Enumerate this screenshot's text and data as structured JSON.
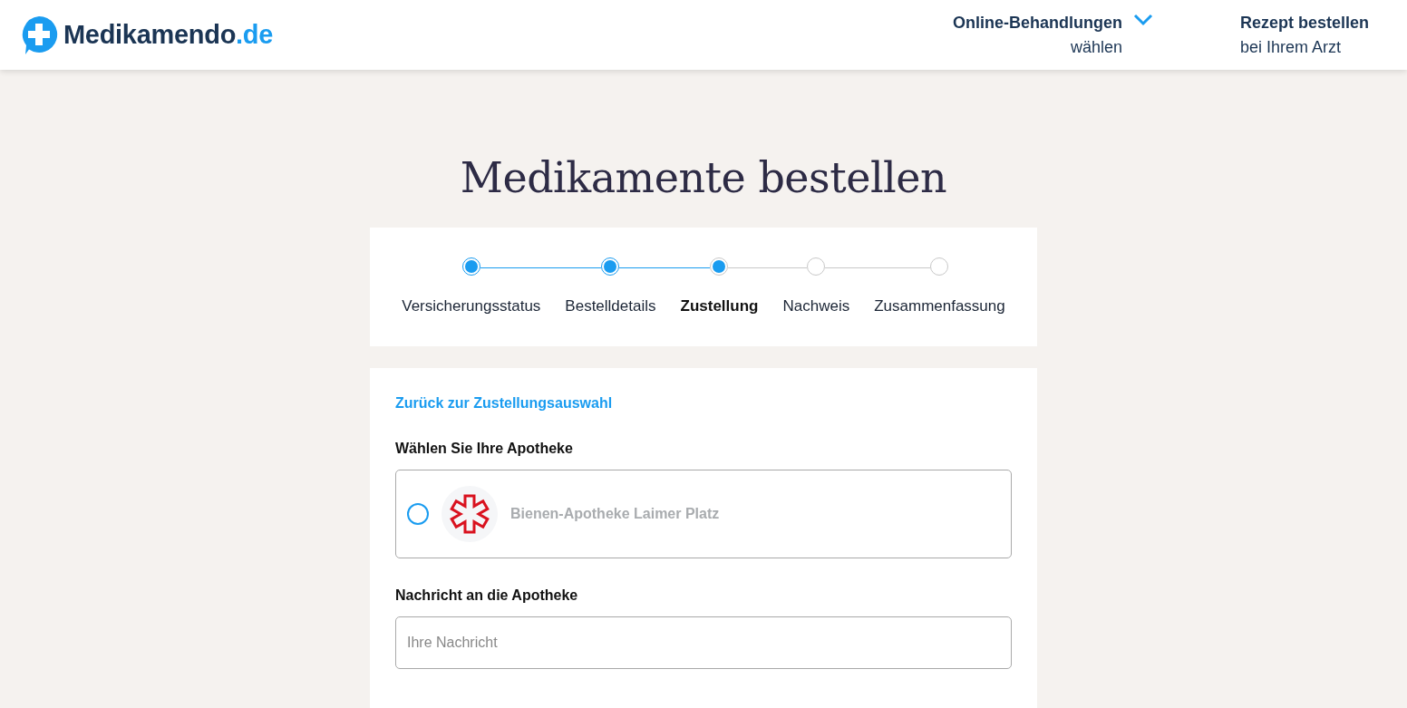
{
  "header": {
    "logo": {
      "name": "Medikamendo",
      "tld": ".de"
    },
    "nav": [
      {
        "title": "Online-Behandlungen",
        "subtitle": "wählen",
        "dropdown": true
      },
      {
        "title": "Rezept bestellen",
        "subtitle": "bei Ihrem Arzt",
        "dropdown": false
      }
    ]
  },
  "page_title": "Medikamente bestellen",
  "steps": [
    {
      "label": "Versicherungsstatus",
      "completed": true,
      "selected": false
    },
    {
      "label": "Bestelldetails",
      "completed": true,
      "selected": false
    },
    {
      "label": "Zustellung",
      "completed": false,
      "selected": true
    },
    {
      "label": "Nachweis",
      "completed": false,
      "selected": false
    },
    {
      "label": "Zusammenfassung",
      "completed": false,
      "selected": false
    }
  ],
  "form": {
    "back_link": "Zurück zur Zustellungsauswahl",
    "pharmacy_heading": "Wählen Sie Ihre Apotheke",
    "pharmacies": [
      {
        "name": "Bienen-Apotheke Laimer Platz",
        "selected": false
      }
    ],
    "message_heading": "Nachricht an die Apotheke",
    "message": {
      "placeholder": "Ihre Nachricht"
    }
  }
}
